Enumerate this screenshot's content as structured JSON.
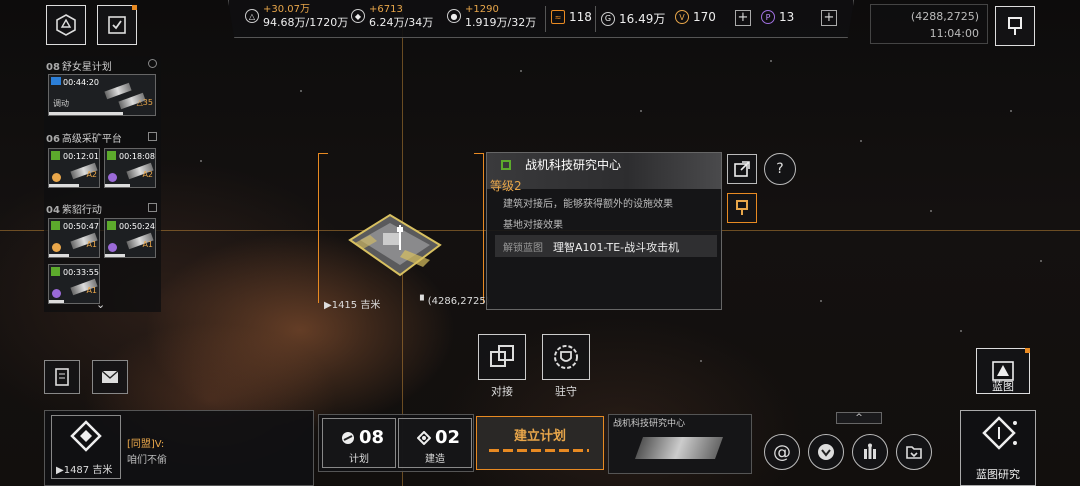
{
  "top_bar": {
    "resources": [
      {
        "icon": "triangle-ore-icon",
        "increase": "+30.07万",
        "amount": "94.68万/1720万"
      },
      {
        "icon": "crystal-ore-icon",
        "increase": "+6713",
        "amount": "6.24万/34万"
      },
      {
        "icon": "gas-ore-icon",
        "increase": "+1290",
        "amount": "1.919万/32万"
      }
    ],
    "stat_118": "118",
    "currency_1": "16.49万",
    "currency_2": "170",
    "currency_3": "13"
  },
  "coord_box": {
    "coords": "(4288,2725)",
    "time": "11:04:00"
  },
  "tasks": [
    {
      "num": "08",
      "name": "舒女星计划",
      "cards": [
        {
          "timer": "00:44:20",
          "status": "调动",
          "tag": "△35"
        }
      ]
    },
    {
      "num": "06",
      "name": "高级采矿平台",
      "cards": [
        {
          "timer": "00:12:01",
          "tag": "A2"
        },
        {
          "timer": "00:18:08",
          "tag": "A2"
        }
      ]
    },
    {
      "num": "04",
      "name": "紫貂行动",
      "cards": [
        {
          "timer": "00:50:47",
          "tag": "A1"
        },
        {
          "timer": "00:50:24",
          "tag": "A1"
        },
        {
          "timer": "00:33:55",
          "tag": "A1"
        }
      ]
    }
  ],
  "structure": {
    "distance": "1415 吉米",
    "coords": "(4286,2725)"
  },
  "info_panel": {
    "title": "战机科技研究中心",
    "level": "等级2",
    "desc": "建筑对接后，能够获得额外的设施效果",
    "effect": "基地对接效果",
    "unlock_label": "解锁蓝图",
    "unlock_value": "理智A101-TE-战斗攻击机"
  },
  "actions": {
    "dock": "对接",
    "garrison": "驻守"
  },
  "blueprint_btn": "蓝图",
  "bottom": {
    "distance": "1487 吉米",
    "chat_channel": "[同盟]V:",
    "chat_msg": "咱们不偷",
    "plan_count": "08",
    "plan_label": "计划",
    "build_count": "02",
    "build_label": "建造",
    "build_plan": "建立计划",
    "preview_title": "战机科技研究中心",
    "blueprint_research": "蓝图研究"
  },
  "colors": {
    "accent": "#e88a22",
    "positive": "#e8a64a",
    "bg": "#0b0a0a"
  }
}
